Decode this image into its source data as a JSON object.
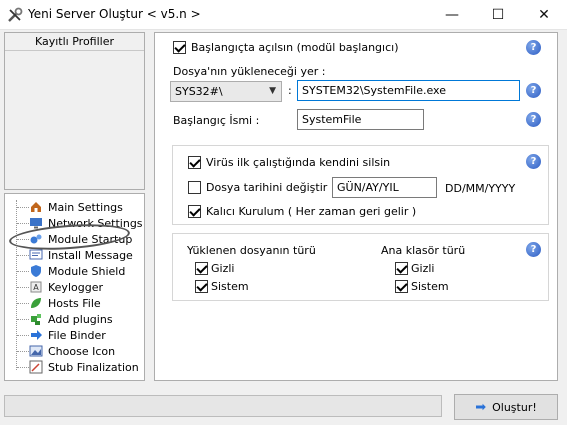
{
  "window": {
    "title": "Yeni Server Oluştur < v5.n >",
    "icon": "tools-icon",
    "controls": {
      "minimize": "—",
      "maximize": "☐",
      "close": "✕"
    }
  },
  "profiles": {
    "header": "Kayıtlı Profiller"
  },
  "tree": {
    "items": [
      {
        "label": "Main Settings",
        "icon": "house-icon",
        "color": "#c0661c"
      },
      {
        "label": "Network Settings",
        "icon": "monitor-icon",
        "color": "#3b73c8"
      },
      {
        "label": "Module Startup",
        "icon": "gears-icon",
        "color": "#3a7ad6"
      },
      {
        "label": "Install Message",
        "icon": "message-icon",
        "color": "#4a6ab0"
      },
      {
        "label": "Module Shield",
        "icon": "shield-icon",
        "color": "#3a7ad6"
      },
      {
        "label": "Keylogger",
        "icon": "keyboard-icon",
        "color": "#888888"
      },
      {
        "label": "Hosts File",
        "icon": "leaf-icon",
        "color": "#3aa03a"
      },
      {
        "label": "Add plugins",
        "icon": "puzzle-icon",
        "color": "#3aa03a"
      },
      {
        "label": "File Binder",
        "icon": "arrow-icon",
        "color": "#2a72d8"
      },
      {
        "label": "Choose Icon",
        "icon": "image-icon",
        "color": "#4466aa"
      },
      {
        "label": "Stub Finalization",
        "icon": "wand-icon",
        "color": "#666666"
      }
    ]
  },
  "startup": {
    "run_at_start_label": "Başlangıçta açılsın (modül başlangıcı)",
    "run_at_start_checked": true,
    "install_path_label": "Dosya'nın yükleneceği yer :",
    "install_dir_value": "SYS32#\\",
    "colon": ":",
    "file_name_value": "SYSTEM32\\SystemFile.exe",
    "startup_name_label": "Başlangıç İsmi :",
    "startup_name_value": "SystemFile",
    "help": "?"
  },
  "options": {
    "delete_self_label": "Virüs ilk çalıştığında kendini silsin",
    "delete_self_checked": true,
    "change_date_label": "Dosya tarihini değiştir :",
    "change_date_checked": false,
    "date_value": "GÜN/AY/YIL",
    "date_format": "DD/MM/YYYY",
    "persistent_label": "Kalıcı Kurulum ( Her zaman geri gelir )",
    "persistent_checked": true
  },
  "attributes": {
    "file_type_title": "Yüklenen dosyanın türü",
    "folder_type_title": "Ana klasör türü",
    "hidden_label": "Gizli",
    "system_label": "Sistem",
    "file_hidden_checked": true,
    "file_system_checked": true,
    "folder_hidden_checked": true,
    "folder_system_checked": true
  },
  "footer": {
    "build_label": "Oluştur!",
    "progress": 0
  }
}
